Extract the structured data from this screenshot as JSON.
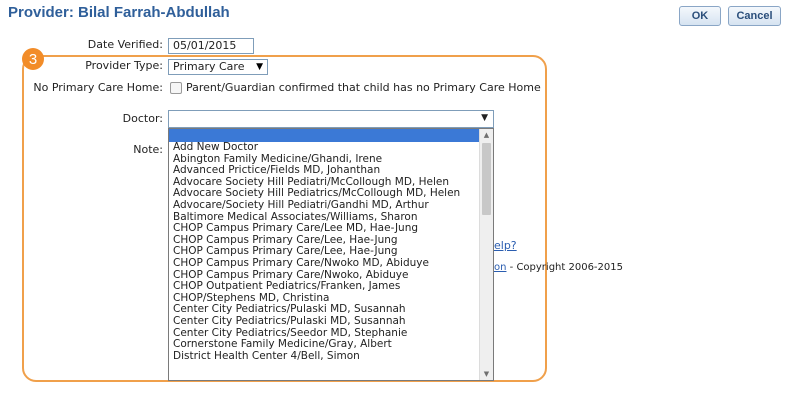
{
  "header": {
    "title": "Provider: Bilal Farrah-Abdullah",
    "ok_label": "OK",
    "cancel_label": "Cancel"
  },
  "step_badge": "3",
  "form": {
    "date_verified_label": "Date Verified:",
    "date_verified_value": "05/01/2015",
    "provider_type_label": "Provider Type:",
    "provider_type_value": "Primary Care",
    "no_primary_care_home_label": "No Primary Care Home:",
    "no_primary_care_home_checkbox_label": "Parent/Guardian confirmed that child has no Primary Care Home",
    "doctor_label": "Doctor:",
    "doctor_value": "",
    "note_label": "Note:"
  },
  "doctor_options": [
    "Add New Doctor",
    "Abington Family Medicine/Ghandi, Irene",
    "Advanced Prictice/Fields MD, Johanthan",
    "Advocare Society Hill Pediatri/McCollough MD, Helen",
    "Advocare Society Hill Pediatrics/McCollough MD, Helen",
    "Advocare/Society Hill Pediatri/Gandhi MD, Arthur",
    "Baltimore Medical Associates/Williams, Sharon",
    "CHOP Campus Primary Care/Lee MD, Hae-Jung",
    "CHOP Campus Primary Care/Lee, Hae-Jung",
    "CHOP Campus Primary Care/Lee, Hae-Jung",
    "CHOP Campus Primary Care/Nwoko MD, Abiduye",
    "CHOP Campus Primary Care/Nwoko, Abiduye",
    "CHOP Outpatient Pediatrics/Franken, James",
    "CHOP/Stephens MD, Christina",
    "Center City Pediatrics/Pulaski MD, Susannah",
    "Center City Pediatrics/Pulaski MD, Susannah",
    "Center City Pediatrics/Seedor MD, Stephanie",
    "Cornerstone Family Medicine/Gray, Albert",
    "District Health Center 4/Bell, Simon"
  ],
  "background_text": {
    "help_fragment": "elp?",
    "copyright_link_fragment": "on",
    "copyright_text": "- Copyright 2006-2015"
  },
  "icons": {
    "dropdown_arrow": "▼",
    "scroll_up": "▲",
    "scroll_down": "▼"
  },
  "colors": {
    "title": "#2f5f9a",
    "highlight": "#3b79d6",
    "frame": "#f0a04b",
    "badge": "#f28c28"
  }
}
